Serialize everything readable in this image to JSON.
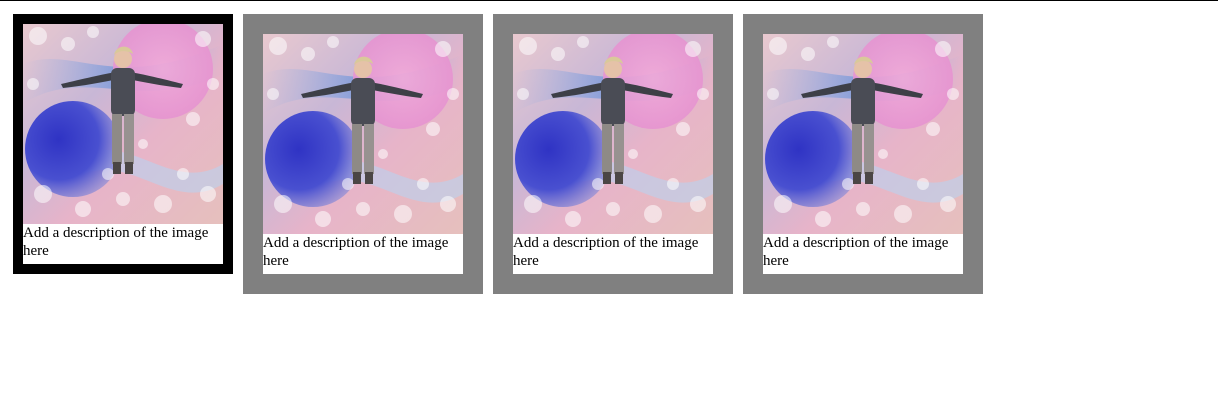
{
  "gallery": {
    "items": [
      {
        "caption": "Add a description of the image here",
        "state": "selected"
      },
      {
        "caption": "Add a description of the image here",
        "state": "normal"
      },
      {
        "caption": "Add a description of the image here",
        "state": "normal"
      },
      {
        "caption": "Add a description of the image here",
        "state": "normal"
      }
    ]
  },
  "colors": {
    "selected_border": "#000000",
    "normal_border": "#808080",
    "caption_background": "#ffffff"
  }
}
